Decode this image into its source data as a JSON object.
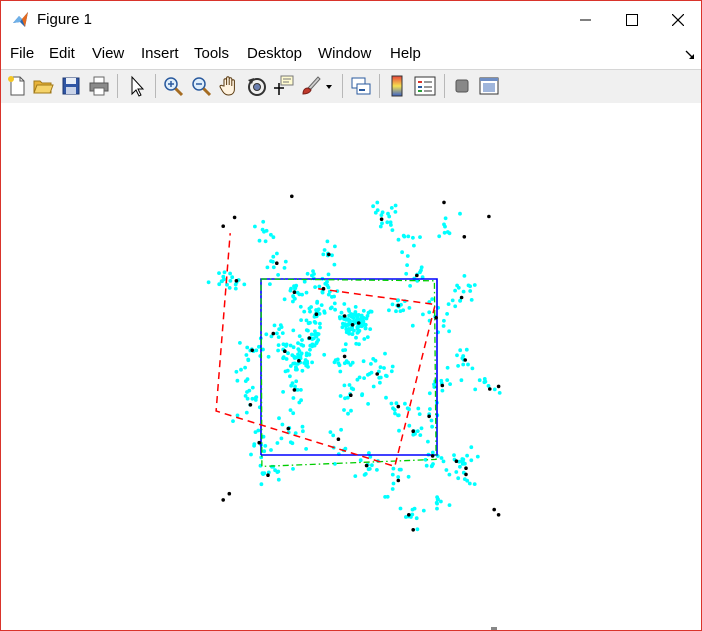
{
  "window": {
    "title": "Figure 1",
    "accent": "#d9342b"
  },
  "menubar": {
    "items": [
      "File",
      "Edit",
      "View",
      "Insert",
      "Tools",
      "Desktop",
      "Window",
      "Help"
    ]
  },
  "toolbar": {
    "icons": [
      "new-figure-icon",
      "open-file-icon",
      "save-icon",
      "print-icon",
      "select-arrow-icon",
      "zoom-in-icon",
      "zoom-out-icon",
      "pan-hand-icon",
      "rotate-3d-icon",
      "data-cursor-icon",
      "brush-icon",
      "brush-dropdown-icon",
      "link-plot-icon",
      "colorbar-icon",
      "legend-icon",
      "hide-plot-tools-icon",
      "show-plot-tools-icon"
    ]
  },
  "chart_data": {
    "type": "scatter",
    "title": "",
    "xlabel": "",
    "ylabel": "",
    "xlim": [
      -1.6,
      1.6
    ],
    "ylim": [
      -1.6,
      1.6
    ],
    "grid": false,
    "axes_visible": false,
    "colors": {
      "cluster_points": "#00ffff",
      "centers": "#000000",
      "reference_square": "#0000ff",
      "green_quad": "#00cc00",
      "red_quad": "#ff0000"
    },
    "series": [
      {
        "style": "cyan dots",
        "clusters": [
          {
            "center": [
              0.11,
              0.5
            ],
            "n": 50,
            "spread": 0.09
          },
          {
            "center": [
              0.04,
              0.48
            ],
            "n": 30,
            "spread": 0.07
          },
          {
            "center": [
              -0.57,
              0.07
            ],
            "n": 38,
            "spread": 0.08
          },
          {
            "center": [
              -0.45,
              0.33
            ],
            "n": 26,
            "spread": 0.08
          },
          {
            "center": [
              -0.37,
              0.6
            ],
            "n": 22,
            "spread": 0.08
          },
          {
            "center": [
              -0.62,
              0.85
            ],
            "n": 18,
            "spread": 0.08
          },
          {
            "center": [
              -0.29,
              0.89
            ],
            "n": 12,
            "spread": 0.07
          },
          {
            "center": [
              -0.05,
              0.58
            ],
            "n": 10,
            "spread": 0.06
          },
          {
            "center": [
              0.56,
              0.7
            ],
            "n": 12,
            "spread": 0.07
          },
          {
            "center": [
              -0.73,
              0.18
            ],
            "n": 14,
            "spread": 0.09
          },
          {
            "center": [
              -0.05,
              0.12
            ],
            "n": 16,
            "spread": 0.08
          },
          {
            "center": [
              0.32,
              -0.08
            ],
            "n": 22,
            "spread": 0.1
          },
          {
            "center": [
              0.56,
              -0.45
            ],
            "n": 10,
            "spread": 0.08
          },
          {
            "center": [
              0.02,
              -0.32
            ],
            "n": 14,
            "spread": 0.08
          },
          {
            "center": [
              -0.62,
              -0.26
            ],
            "n": 12,
            "spread": 0.08
          },
          {
            "center": [
              -0.69,
              -0.7
            ],
            "n": 14,
            "spread": 0.09
          },
          {
            "center": [
              -1.12,
              -0.43
            ],
            "n": 14,
            "spread": 0.1
          },
          {
            "center": [
              -0.86,
              0.38
            ],
            "n": 10,
            "spread": 0.09
          },
          {
            "center": [
              -1.1,
              0.19
            ],
            "n": 12,
            "spread": 0.1
          },
          {
            "center": [
              -1.28,
              0.98
            ],
            "n": 10,
            "spread": 0.08
          },
          {
            "center": [
              -0.82,
              1.18
            ],
            "n": 10,
            "spread": 0.09
          },
          {
            "center": [
              -0.23,
              1.28
            ],
            "n": 8,
            "spread": 0.07
          },
          {
            "center": [
              0.37,
              1.68
            ],
            "n": 16,
            "spread": 0.1
          },
          {
            "center": [
              0.77,
              1.04
            ],
            "n": 10,
            "spread": 0.08
          },
          {
            "center": [
              0.99,
              0.56
            ],
            "n": 14,
            "spread": 0.1
          },
          {
            "center": [
              1.28,
              0.79
            ],
            "n": 14,
            "spread": 0.1
          },
          {
            "center": [
              1.32,
              0.08
            ],
            "n": 12,
            "spread": 0.09
          },
          {
            "center": [
              1.06,
              -0.21
            ],
            "n": 10,
            "spread": 0.09
          },
          {
            "center": [
              0.91,
              -0.56
            ],
            "n": 10,
            "spread": 0.08
          },
          {
            "center": [
              0.95,
              -1.01
            ],
            "n": 10,
            "spread": 0.08
          },
          {
            "center": [
              1.33,
              -1.15
            ],
            "n": 16,
            "spread": 0.1
          },
          {
            "center": [
              0.56,
              -1.29
            ],
            "n": 10,
            "spread": 0.09
          },
          {
            "center": [
              0.2,
              -1.12
            ],
            "n": 12,
            "spread": 0.09
          },
          {
            "center": [
              -0.12,
              -0.82
            ],
            "n": 8,
            "spread": 0.07
          },
          {
            "center": [
              0.73,
              -0.73
            ],
            "n": 8,
            "spread": 0.07
          },
          {
            "center": [
              -0.92,
              -1.23
            ],
            "n": 14,
            "spread": 0.09
          },
          {
            "center": [
              -1.02,
              -0.86
            ],
            "n": 10,
            "spread": 0.08
          },
          {
            "center": [
              0.62,
              1.44
            ],
            "n": 10,
            "spread": 0.08
          },
          {
            "center": [
              1.1,
              1.58
            ],
            "n": 8,
            "spread": 0.08
          },
          {
            "center": [
              -0.99,
              1.52
            ],
            "n": 8,
            "spread": 0.08
          },
          {
            "center": [
              -1.45,
              0.96
            ],
            "n": 8,
            "spread": 0.07
          },
          {
            "center": [
              1.58,
              -0.23
            ],
            "n": 8,
            "spread": 0.07
          },
          {
            "center": [
              0.72,
              -1.7
            ],
            "n": 10,
            "spread": 0.08
          },
          {
            "center": [
              1.02,
              -1.54
            ],
            "n": 8,
            "spread": 0.07
          },
          {
            "center": [
              1.27,
              -1.06
            ],
            "n": 8,
            "spread": 0.07
          },
          {
            "center": [
              -1.21,
              -0.1
            ],
            "n": 6,
            "spread": 0.07
          },
          {
            "center": [
              -0.19,
              0.77
            ],
            "n": 8,
            "spread": 0.07
          },
          {
            "center": [
              -0.43,
              1.04
            ],
            "n": 6,
            "spread": 0.06
          }
        ]
      },
      {
        "style": "black dots",
        "points": [
          [
            0.11,
            0.5
          ],
          [
            0.04,
            0.48
          ],
          [
            -0.57,
            0.07
          ],
          [
            -0.45,
            0.33
          ],
          [
            -0.37,
            0.6
          ],
          [
            -0.62,
            0.85
          ],
          [
            -0.29,
            0.89
          ],
          [
            -0.05,
            0.58
          ],
          [
            0.56,
            0.7
          ],
          [
            -0.73,
            0.18
          ],
          [
            -0.05,
            0.12
          ],
          [
            0.32,
            -0.08
          ],
          [
            0.56,
            -0.45
          ],
          [
            0.02,
            -0.32
          ],
          [
            -0.62,
            -0.26
          ],
          [
            -0.69,
            -0.7
          ],
          [
            -1.12,
            -0.43
          ],
          [
            -0.86,
            0.38
          ],
          [
            -1.1,
            0.19
          ],
          [
            -1.28,
            0.98
          ],
          [
            -0.82,
            1.18
          ],
          [
            -0.23,
            1.28
          ],
          [
            0.37,
            1.68
          ],
          [
            0.77,
            1.04
          ],
          [
            0.99,
            0.56
          ],
          [
            1.28,
            0.79
          ],
          [
            1.32,
            0.08
          ],
          [
            1.06,
            -0.21
          ],
          [
            0.91,
            -0.56
          ],
          [
            0.95,
            -1.01
          ],
          [
            1.33,
            -1.15
          ],
          [
            0.56,
            -1.29
          ],
          [
            0.2,
            -1.12
          ],
          [
            -0.12,
            -0.82
          ],
          [
            0.73,
            -0.73
          ],
          [
            -0.92,
            -1.23
          ],
          [
            -1.02,
            -0.86
          ],
          [
            -1.43,
            1.6
          ],
          [
            -1.3,
            1.7
          ],
          [
            -0.65,
            1.94
          ],
          [
            1.59,
            1.71
          ],
          [
            1.08,
            1.87
          ],
          [
            1.31,
            1.48
          ],
          [
            -1.43,
            -1.51
          ],
          [
            -1.36,
            -1.44
          ],
          [
            1.65,
            -1.62
          ],
          [
            1.7,
            -1.68
          ],
          [
            1.6,
            -0.25
          ],
          [
            1.7,
            -0.22
          ],
          [
            0.68,
            -1.68
          ],
          [
            0.73,
            -1.85
          ],
          [
            1.22,
            -1.07
          ],
          [
            1.33,
            -1.22
          ]
        ]
      },
      {
        "style": "blue solid square",
        "points": [
          [
            -1,
            -1
          ],
          [
            1,
            -1
          ],
          [
            1,
            1
          ],
          [
            -1,
            1
          ],
          [
            -1,
            -1
          ]
        ]
      },
      {
        "style": "green dash-dot quad",
        "points": [
          [
            -1,
            1
          ],
          [
            0.97,
            0.98
          ],
          [
            0.99,
            -1.05
          ],
          [
            -0.99,
            -1.13
          ],
          [
            -1,
            1
          ]
        ]
      },
      {
        "style": "red dashed quad",
        "points": [
          [
            -0.35,
            0.89
          ],
          [
            0.98,
            0.71
          ],
          [
            0.52,
            -1.13
          ],
          [
            -1.51,
            -0.5
          ],
          [
            -1.35,
            1.52
          ]
        ]
      }
    ]
  }
}
